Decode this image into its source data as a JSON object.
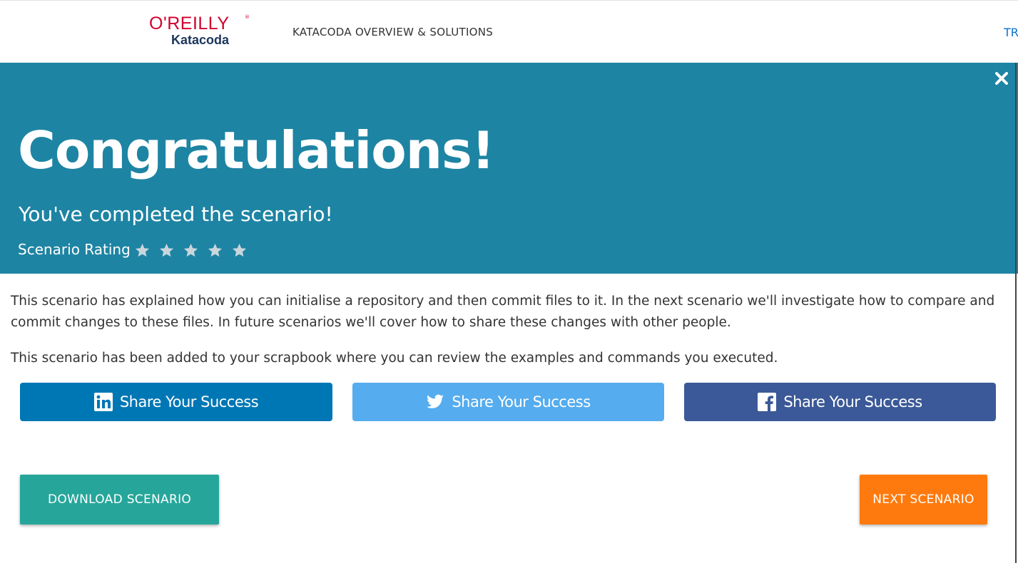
{
  "header": {
    "logo_line1": "O'REILLY",
    "logo_reg": "®",
    "logo_line2": "Katacoda",
    "nav_overview": "KATACODA OVERVIEW & SOLUTIONS",
    "nav_right_partial": "TR"
  },
  "modal": {
    "close_symbol": "×",
    "title": "Congratulations!",
    "subtitle": "You've completed the scenario!",
    "rating_label": "Scenario Rating",
    "rating_stars_total": 5,
    "rating_value": 0,
    "paragraph1": "This scenario has explained how you can initialise a repository and then commit files to it. In the next scenario we'll investigate how to compare and commit changes to these files. In future scenarios we'll cover how to share these changes with other people.",
    "paragraph2": "This scenario has been added to your scrapbook where you can review the examples and commands you executed.",
    "share": [
      {
        "network": "linkedin",
        "icon": "linkedin-icon",
        "label": "Share Your Success"
      },
      {
        "network": "twitter",
        "icon": "twitter-icon",
        "label": "Share Your Success"
      },
      {
        "network": "facebook",
        "icon": "facebook-icon",
        "label": "Share Your Success"
      }
    ],
    "download_label": "DOWNLOAD SCENARIO",
    "next_label": "NEXT SCENARIO"
  },
  "colors": {
    "hero_bg": "#1e84a3",
    "linkedin": "#0077b5",
    "twitter": "#55acee",
    "facebook": "#3b5998",
    "download": "#26a69a",
    "next": "#ff7a0e",
    "brand_red": "#d3002d",
    "brand_navy": "#1b365d"
  }
}
